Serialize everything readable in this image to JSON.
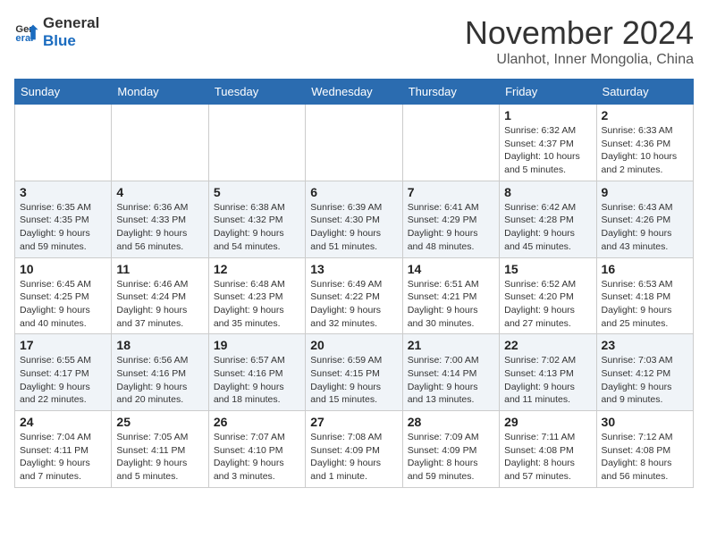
{
  "logo": {
    "line1": "General",
    "line2": "Blue"
  },
  "title": "November 2024",
  "location": "Ulanhot, Inner Mongolia, China",
  "weekdays": [
    "Sunday",
    "Monday",
    "Tuesday",
    "Wednesday",
    "Thursday",
    "Friday",
    "Saturday"
  ],
  "weeks": [
    [
      {
        "day": "",
        "detail": ""
      },
      {
        "day": "",
        "detail": ""
      },
      {
        "day": "",
        "detail": ""
      },
      {
        "day": "",
        "detail": ""
      },
      {
        "day": "",
        "detail": ""
      },
      {
        "day": "1",
        "detail": "Sunrise: 6:32 AM\nSunset: 4:37 PM\nDaylight: 10 hours\nand 5 minutes."
      },
      {
        "day": "2",
        "detail": "Sunrise: 6:33 AM\nSunset: 4:36 PM\nDaylight: 10 hours\nand 2 minutes."
      }
    ],
    [
      {
        "day": "3",
        "detail": "Sunrise: 6:35 AM\nSunset: 4:35 PM\nDaylight: 9 hours\nand 59 minutes."
      },
      {
        "day": "4",
        "detail": "Sunrise: 6:36 AM\nSunset: 4:33 PM\nDaylight: 9 hours\nand 56 minutes."
      },
      {
        "day": "5",
        "detail": "Sunrise: 6:38 AM\nSunset: 4:32 PM\nDaylight: 9 hours\nand 54 minutes."
      },
      {
        "day": "6",
        "detail": "Sunrise: 6:39 AM\nSunset: 4:30 PM\nDaylight: 9 hours\nand 51 minutes."
      },
      {
        "day": "7",
        "detail": "Sunrise: 6:41 AM\nSunset: 4:29 PM\nDaylight: 9 hours\nand 48 minutes."
      },
      {
        "day": "8",
        "detail": "Sunrise: 6:42 AM\nSunset: 4:28 PM\nDaylight: 9 hours\nand 45 minutes."
      },
      {
        "day": "9",
        "detail": "Sunrise: 6:43 AM\nSunset: 4:26 PM\nDaylight: 9 hours\nand 43 minutes."
      }
    ],
    [
      {
        "day": "10",
        "detail": "Sunrise: 6:45 AM\nSunset: 4:25 PM\nDaylight: 9 hours\nand 40 minutes."
      },
      {
        "day": "11",
        "detail": "Sunrise: 6:46 AM\nSunset: 4:24 PM\nDaylight: 9 hours\nand 37 minutes."
      },
      {
        "day": "12",
        "detail": "Sunrise: 6:48 AM\nSunset: 4:23 PM\nDaylight: 9 hours\nand 35 minutes."
      },
      {
        "day": "13",
        "detail": "Sunrise: 6:49 AM\nSunset: 4:22 PM\nDaylight: 9 hours\nand 32 minutes."
      },
      {
        "day": "14",
        "detail": "Sunrise: 6:51 AM\nSunset: 4:21 PM\nDaylight: 9 hours\nand 30 minutes."
      },
      {
        "day": "15",
        "detail": "Sunrise: 6:52 AM\nSunset: 4:20 PM\nDaylight: 9 hours\nand 27 minutes."
      },
      {
        "day": "16",
        "detail": "Sunrise: 6:53 AM\nSunset: 4:18 PM\nDaylight: 9 hours\nand 25 minutes."
      }
    ],
    [
      {
        "day": "17",
        "detail": "Sunrise: 6:55 AM\nSunset: 4:17 PM\nDaylight: 9 hours\nand 22 minutes."
      },
      {
        "day": "18",
        "detail": "Sunrise: 6:56 AM\nSunset: 4:16 PM\nDaylight: 9 hours\nand 20 minutes."
      },
      {
        "day": "19",
        "detail": "Sunrise: 6:57 AM\nSunset: 4:16 PM\nDaylight: 9 hours\nand 18 minutes."
      },
      {
        "day": "20",
        "detail": "Sunrise: 6:59 AM\nSunset: 4:15 PM\nDaylight: 9 hours\nand 15 minutes."
      },
      {
        "day": "21",
        "detail": "Sunrise: 7:00 AM\nSunset: 4:14 PM\nDaylight: 9 hours\nand 13 minutes."
      },
      {
        "day": "22",
        "detail": "Sunrise: 7:02 AM\nSunset: 4:13 PM\nDaylight: 9 hours\nand 11 minutes."
      },
      {
        "day": "23",
        "detail": "Sunrise: 7:03 AM\nSunset: 4:12 PM\nDaylight: 9 hours\nand 9 minutes."
      }
    ],
    [
      {
        "day": "24",
        "detail": "Sunrise: 7:04 AM\nSunset: 4:11 PM\nDaylight: 9 hours\nand 7 minutes."
      },
      {
        "day": "25",
        "detail": "Sunrise: 7:05 AM\nSunset: 4:11 PM\nDaylight: 9 hours\nand 5 minutes."
      },
      {
        "day": "26",
        "detail": "Sunrise: 7:07 AM\nSunset: 4:10 PM\nDaylight: 9 hours\nand 3 minutes."
      },
      {
        "day": "27",
        "detail": "Sunrise: 7:08 AM\nSunset: 4:09 PM\nDaylight: 9 hours\nand 1 minute."
      },
      {
        "day": "28",
        "detail": "Sunrise: 7:09 AM\nSunset: 4:09 PM\nDaylight: 8 hours\nand 59 minutes."
      },
      {
        "day": "29",
        "detail": "Sunrise: 7:11 AM\nSunset: 4:08 PM\nDaylight: 8 hours\nand 57 minutes."
      },
      {
        "day": "30",
        "detail": "Sunrise: 7:12 AM\nSunset: 4:08 PM\nDaylight: 8 hours\nand 56 minutes."
      }
    ]
  ]
}
